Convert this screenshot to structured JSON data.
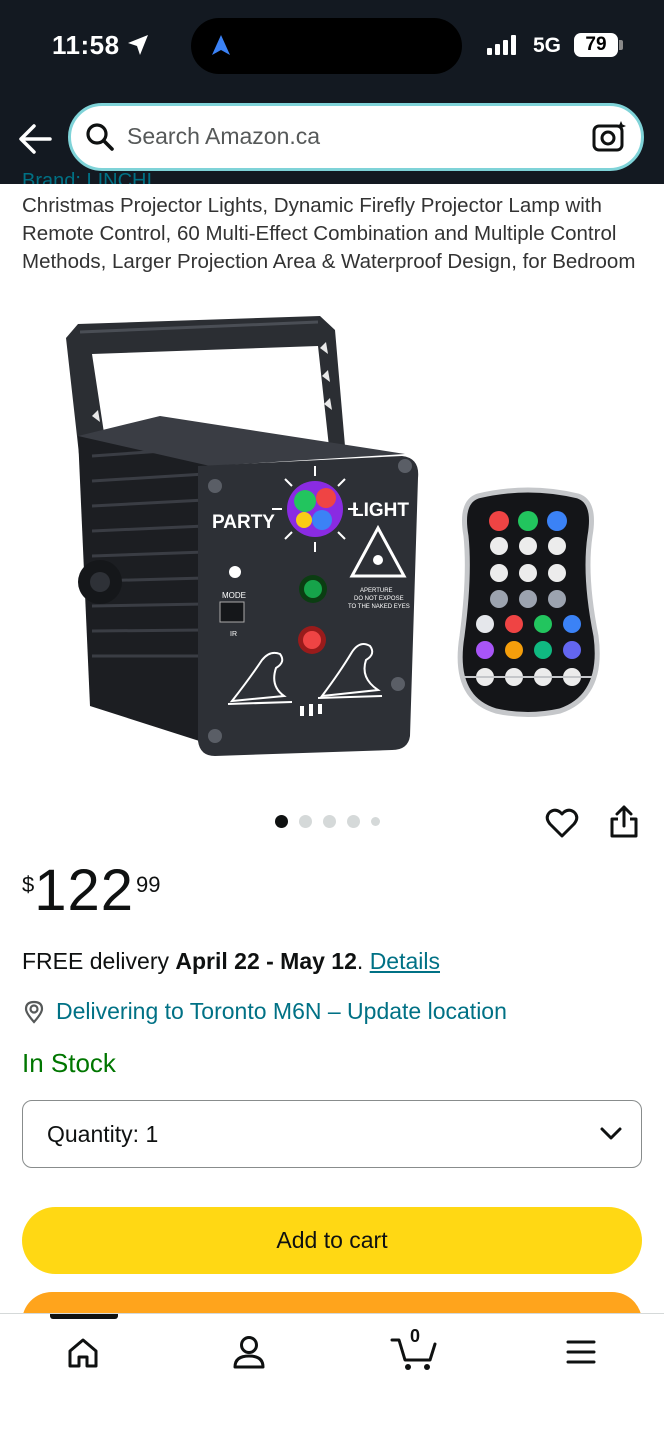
{
  "status_bar": {
    "time": "11:58",
    "network": "5G",
    "battery": "79"
  },
  "search": {
    "placeholder": "Search Amazon.ca"
  },
  "product": {
    "brand": "Brand: LINCHI",
    "title": "Christmas Projector Lights, Dynamic Firefly Projector Lamp with Remote Control, 60 Multi-Effect Combination and Multiple Control Methods, Larger Projection Area & Waterproof Design, for Bedroom",
    "image_text": {
      "party": "PARTY",
      "light": "LIGHT",
      "mode": "MODE",
      "ir": "IR",
      "aperture": "APERTURE",
      "warning1": "DO NOT EXPOSE",
      "warning2": "TO THE NAKED EYES"
    },
    "image_count": 5,
    "active_image": 1
  },
  "price": {
    "symbol": "$",
    "whole": "122",
    "fraction": "99"
  },
  "delivery": {
    "prefix": "FREE delivery ",
    "dates": "April 22 - May 12",
    "suffix": ". ",
    "details_link": "Details"
  },
  "location": {
    "text": "Delivering to Toronto M6N – Update location"
  },
  "stock": {
    "status": "In Stock"
  },
  "quantity": {
    "label": "Quantity:",
    "value": "1"
  },
  "buttons": {
    "add_to_cart": "Add to cart"
  },
  "bottom_nav": {
    "items": [
      "home-icon",
      "account-icon",
      "cart-icon",
      "menu-icon"
    ],
    "cart_count": "0"
  },
  "colors": {
    "header_bg": "#131921",
    "link": "#007185",
    "in_stock": "#007600",
    "add_to_cart": "#FFD814",
    "buy_now": "#FFA41C"
  }
}
